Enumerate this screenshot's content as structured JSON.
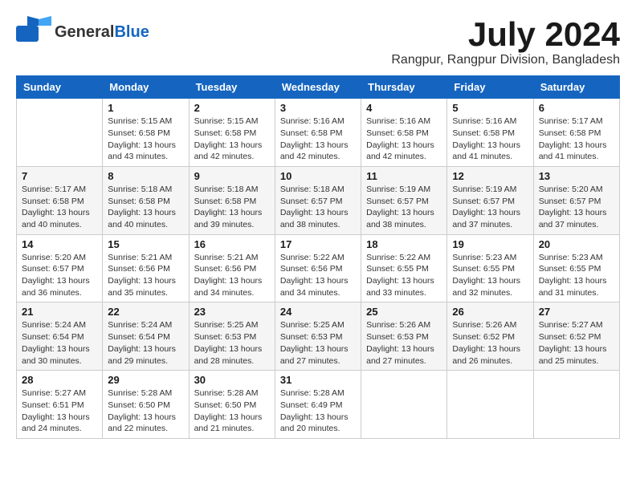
{
  "header": {
    "logo_general": "General",
    "logo_blue": "Blue",
    "month_year": "July 2024",
    "location": "Rangpur, Rangpur Division, Bangladesh"
  },
  "weekdays": [
    "Sunday",
    "Monday",
    "Tuesday",
    "Wednesday",
    "Thursday",
    "Friday",
    "Saturday"
  ],
  "weeks": [
    [
      {
        "day": "",
        "sunrise": "",
        "sunset": "",
        "daylight": ""
      },
      {
        "day": "1",
        "sunrise": "Sunrise: 5:15 AM",
        "sunset": "Sunset: 6:58 PM",
        "daylight": "Daylight: 13 hours and 43 minutes."
      },
      {
        "day": "2",
        "sunrise": "Sunrise: 5:15 AM",
        "sunset": "Sunset: 6:58 PM",
        "daylight": "Daylight: 13 hours and 42 minutes."
      },
      {
        "day": "3",
        "sunrise": "Sunrise: 5:16 AM",
        "sunset": "Sunset: 6:58 PM",
        "daylight": "Daylight: 13 hours and 42 minutes."
      },
      {
        "day": "4",
        "sunrise": "Sunrise: 5:16 AM",
        "sunset": "Sunset: 6:58 PM",
        "daylight": "Daylight: 13 hours and 42 minutes."
      },
      {
        "day": "5",
        "sunrise": "Sunrise: 5:16 AM",
        "sunset": "Sunset: 6:58 PM",
        "daylight": "Daylight: 13 hours and 41 minutes."
      },
      {
        "day": "6",
        "sunrise": "Sunrise: 5:17 AM",
        "sunset": "Sunset: 6:58 PM",
        "daylight": "Daylight: 13 hours and 41 minutes."
      }
    ],
    [
      {
        "day": "7",
        "sunrise": "Sunrise: 5:17 AM",
        "sunset": "Sunset: 6:58 PM",
        "daylight": "Daylight: 13 hours and 40 minutes."
      },
      {
        "day": "8",
        "sunrise": "Sunrise: 5:18 AM",
        "sunset": "Sunset: 6:58 PM",
        "daylight": "Daylight: 13 hours and 40 minutes."
      },
      {
        "day": "9",
        "sunrise": "Sunrise: 5:18 AM",
        "sunset": "Sunset: 6:58 PM",
        "daylight": "Daylight: 13 hours and 39 minutes."
      },
      {
        "day": "10",
        "sunrise": "Sunrise: 5:18 AM",
        "sunset": "Sunset: 6:57 PM",
        "daylight": "Daylight: 13 hours and 38 minutes."
      },
      {
        "day": "11",
        "sunrise": "Sunrise: 5:19 AM",
        "sunset": "Sunset: 6:57 PM",
        "daylight": "Daylight: 13 hours and 38 minutes."
      },
      {
        "day": "12",
        "sunrise": "Sunrise: 5:19 AM",
        "sunset": "Sunset: 6:57 PM",
        "daylight": "Daylight: 13 hours and 37 minutes."
      },
      {
        "day": "13",
        "sunrise": "Sunrise: 5:20 AM",
        "sunset": "Sunset: 6:57 PM",
        "daylight": "Daylight: 13 hours and 37 minutes."
      }
    ],
    [
      {
        "day": "14",
        "sunrise": "Sunrise: 5:20 AM",
        "sunset": "Sunset: 6:57 PM",
        "daylight": "Daylight: 13 hours and 36 minutes."
      },
      {
        "day": "15",
        "sunrise": "Sunrise: 5:21 AM",
        "sunset": "Sunset: 6:56 PM",
        "daylight": "Daylight: 13 hours and 35 minutes."
      },
      {
        "day": "16",
        "sunrise": "Sunrise: 5:21 AM",
        "sunset": "Sunset: 6:56 PM",
        "daylight": "Daylight: 13 hours and 34 minutes."
      },
      {
        "day": "17",
        "sunrise": "Sunrise: 5:22 AM",
        "sunset": "Sunset: 6:56 PM",
        "daylight": "Daylight: 13 hours and 34 minutes."
      },
      {
        "day": "18",
        "sunrise": "Sunrise: 5:22 AM",
        "sunset": "Sunset: 6:55 PM",
        "daylight": "Daylight: 13 hours and 33 minutes."
      },
      {
        "day": "19",
        "sunrise": "Sunrise: 5:23 AM",
        "sunset": "Sunset: 6:55 PM",
        "daylight": "Daylight: 13 hours and 32 minutes."
      },
      {
        "day": "20",
        "sunrise": "Sunrise: 5:23 AM",
        "sunset": "Sunset: 6:55 PM",
        "daylight": "Daylight: 13 hours and 31 minutes."
      }
    ],
    [
      {
        "day": "21",
        "sunrise": "Sunrise: 5:24 AM",
        "sunset": "Sunset: 6:54 PM",
        "daylight": "Daylight: 13 hours and 30 minutes."
      },
      {
        "day": "22",
        "sunrise": "Sunrise: 5:24 AM",
        "sunset": "Sunset: 6:54 PM",
        "daylight": "Daylight: 13 hours and 29 minutes."
      },
      {
        "day": "23",
        "sunrise": "Sunrise: 5:25 AM",
        "sunset": "Sunset: 6:53 PM",
        "daylight": "Daylight: 13 hours and 28 minutes."
      },
      {
        "day": "24",
        "sunrise": "Sunrise: 5:25 AM",
        "sunset": "Sunset: 6:53 PM",
        "daylight": "Daylight: 13 hours and 27 minutes."
      },
      {
        "day": "25",
        "sunrise": "Sunrise: 5:26 AM",
        "sunset": "Sunset: 6:53 PM",
        "daylight": "Daylight: 13 hours and 27 minutes."
      },
      {
        "day": "26",
        "sunrise": "Sunrise: 5:26 AM",
        "sunset": "Sunset: 6:52 PM",
        "daylight": "Daylight: 13 hours and 26 minutes."
      },
      {
        "day": "27",
        "sunrise": "Sunrise: 5:27 AM",
        "sunset": "Sunset: 6:52 PM",
        "daylight": "Daylight: 13 hours and 25 minutes."
      }
    ],
    [
      {
        "day": "28",
        "sunrise": "Sunrise: 5:27 AM",
        "sunset": "Sunset: 6:51 PM",
        "daylight": "Daylight: 13 hours and 24 minutes."
      },
      {
        "day": "29",
        "sunrise": "Sunrise: 5:28 AM",
        "sunset": "Sunset: 6:50 PM",
        "daylight": "Daylight: 13 hours and 22 minutes."
      },
      {
        "day": "30",
        "sunrise": "Sunrise: 5:28 AM",
        "sunset": "Sunset: 6:50 PM",
        "daylight": "Daylight: 13 hours and 21 minutes."
      },
      {
        "day": "31",
        "sunrise": "Sunrise: 5:28 AM",
        "sunset": "Sunset: 6:49 PM",
        "daylight": "Daylight: 13 hours and 20 minutes."
      },
      {
        "day": "",
        "sunrise": "",
        "sunset": "",
        "daylight": ""
      },
      {
        "day": "",
        "sunrise": "",
        "sunset": "",
        "daylight": ""
      },
      {
        "day": "",
        "sunrise": "",
        "sunset": "",
        "daylight": ""
      }
    ]
  ]
}
